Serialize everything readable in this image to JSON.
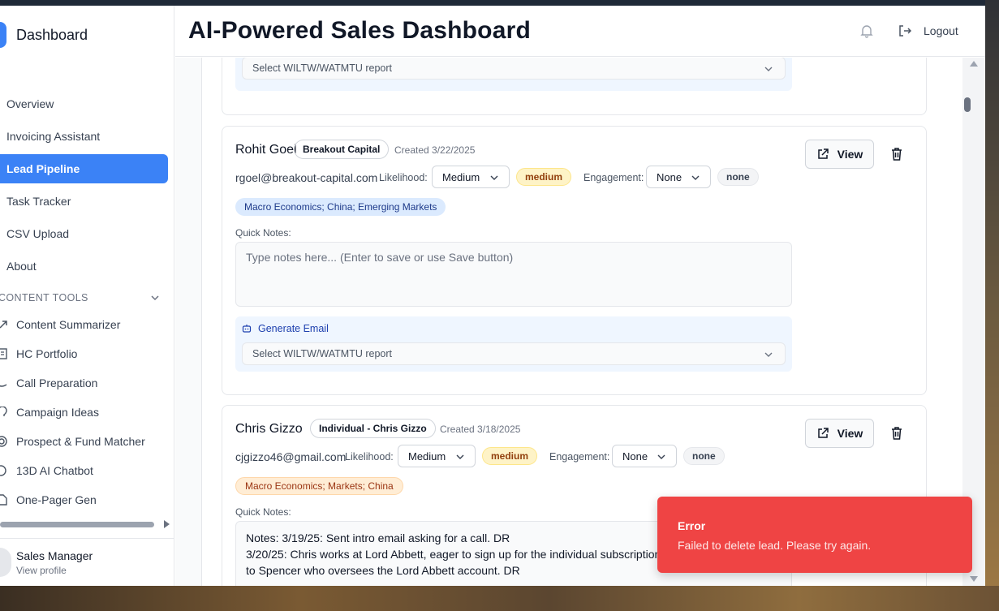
{
  "app": {
    "brand": "Dashboard",
    "page_title": "AI-Powered Sales Dashboard",
    "logout_label": "Logout"
  },
  "sidebar": {
    "nav": [
      {
        "label": "Overview",
        "active": false
      },
      {
        "label": "Invoicing Assistant",
        "active": false
      },
      {
        "label": "Lead Pipeline",
        "active": true
      },
      {
        "label": "Task Tracker",
        "active": false
      },
      {
        "label": "CSV Upload",
        "active": false
      },
      {
        "label": "About",
        "active": false
      }
    ],
    "section_label": "CONTENT TOOLS",
    "tools": [
      {
        "label": "Content Summarizer",
        "icon": "arrow-up-right-icon"
      },
      {
        "label": "HC Portfolio",
        "icon": "building-icon"
      },
      {
        "label": "Call Preparation",
        "icon": "phone-icon"
      },
      {
        "label": "Campaign Ideas",
        "icon": "lightbulb-icon"
      },
      {
        "label": "Prospect & Fund Matcher",
        "icon": "target-icon"
      },
      {
        "label": "13D AI Chatbot",
        "icon": "chat-icon"
      },
      {
        "label": "One-Pager Gen",
        "icon": "document-icon"
      }
    ],
    "profile": {
      "name": "Sales Manager",
      "link": "View profile"
    }
  },
  "top_card": {
    "report_select": "Select WILTW/WATMTU report"
  },
  "leads": [
    {
      "name": "Rohit Goel",
      "company": "Breakout Capital",
      "created": "Created 3/22/2025",
      "email": "rgoel@breakout-capital.com",
      "likelihood_label": "Likelihood:",
      "likelihood_value": "Medium",
      "likelihood_badge": "medium",
      "engagement_label": "Engagement:",
      "engagement_value": "None",
      "engagement_badge": "none",
      "tags": "Macro Economics; China; Emerging Markets",
      "notes_label": "Quick Notes:",
      "notes_placeholder": "Type notes here... (Enter to save or use Save button)",
      "generate_label": "Generate Email",
      "report_select": "Select WILTW/WATMTU report",
      "view_label": "View"
    },
    {
      "name": "Chris Gizzo",
      "company": "Individual - Chris Gizzo",
      "created": "Created 3/18/2025",
      "email": "cjgizzo46@gmail.com",
      "likelihood_label": "Likelihood:",
      "likelihood_value": "Medium",
      "likelihood_badge": "medium",
      "engagement_label": "Engagement:",
      "engagement_value": "None",
      "engagement_badge": "none",
      "tags": "Macro Economics; Markets; China",
      "notes_label": "Quick Notes:",
      "notes_lines": [
        "Notes: 3/19/25: Sent intro email asking for a call. DR",
        "3/20/25: Chris works at Lord Abbett, eager to sign up for the individual subscription",
        "to Spencer who oversees the Lord Abbett account. DR"
      ],
      "view_label": "View"
    }
  ],
  "toast": {
    "title": "Error",
    "message": "Failed to delete lead. Please try again.",
    "color": "#ef4444"
  },
  "colors": {
    "accent": "#3b82f6",
    "medium_badge_bg": "#fef3c7",
    "tag_blue_bg": "#dbeafe",
    "tag_orange_bg": "#ffedd5"
  }
}
